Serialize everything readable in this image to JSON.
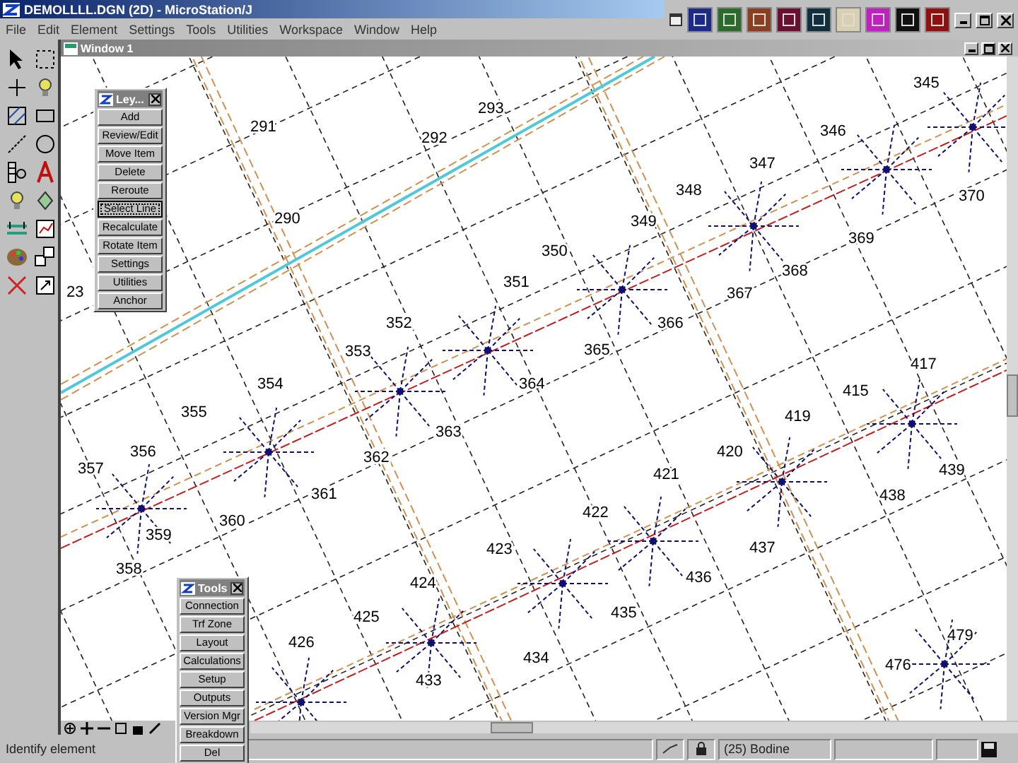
{
  "window": {
    "title": "DEMOLLLL.DGN (2D) - MicroStation/J"
  },
  "menu": [
    "File",
    "Edit",
    "Element",
    "Settings",
    "Tools",
    "Utilities",
    "Workspace",
    "Window",
    "Help"
  ],
  "view_window": {
    "title": "Window 1"
  },
  "map": {
    "parcel_numbers": [
      "291",
      "292",
      "293",
      "290",
      "23",
      "345",
      "346",
      "347",
      "348",
      "349",
      "350",
      "351",
      "352",
      "353",
      "354",
      "355",
      "356",
      "357",
      "358",
      "359",
      "360",
      "361",
      "362",
      "363",
      "364",
      "365",
      "366",
      "367",
      "368",
      "369",
      "370",
      "415",
      "417",
      "419",
      "420",
      "421",
      "422",
      "423",
      "424",
      "425",
      "426",
      "433",
      "434",
      "435",
      "436",
      "437",
      "438",
      "439",
      "476",
      "479"
    ]
  },
  "ley_panel": {
    "title": "Ley...",
    "buttons": [
      {
        "label": "Add",
        "selected": false
      },
      {
        "label": "Review/Edit",
        "selected": false
      },
      {
        "label": "Move Item",
        "selected": false
      },
      {
        "label": "Delete",
        "selected": false
      },
      {
        "label": "Reroute",
        "selected": false
      },
      {
        "label": "Select Line",
        "selected": true
      },
      {
        "label": "Recalculate",
        "selected": false
      },
      {
        "label": "Rotate Item",
        "selected": false
      },
      {
        "label": "Settings",
        "selected": false
      },
      {
        "label": "Utilities",
        "selected": false
      },
      {
        "label": "Anchor",
        "selected": false
      }
    ]
  },
  "tools_panel": {
    "title": "Tools",
    "buttons": [
      "Connection",
      "Trf Zone",
      "Layout",
      "Calculations",
      "Setup",
      "Outputs",
      "Version Mgr",
      "Breakdown",
      "Del"
    ]
  },
  "status_bar": {
    "prompt": "Identify element",
    "level_field": "(25) Bodine"
  }
}
